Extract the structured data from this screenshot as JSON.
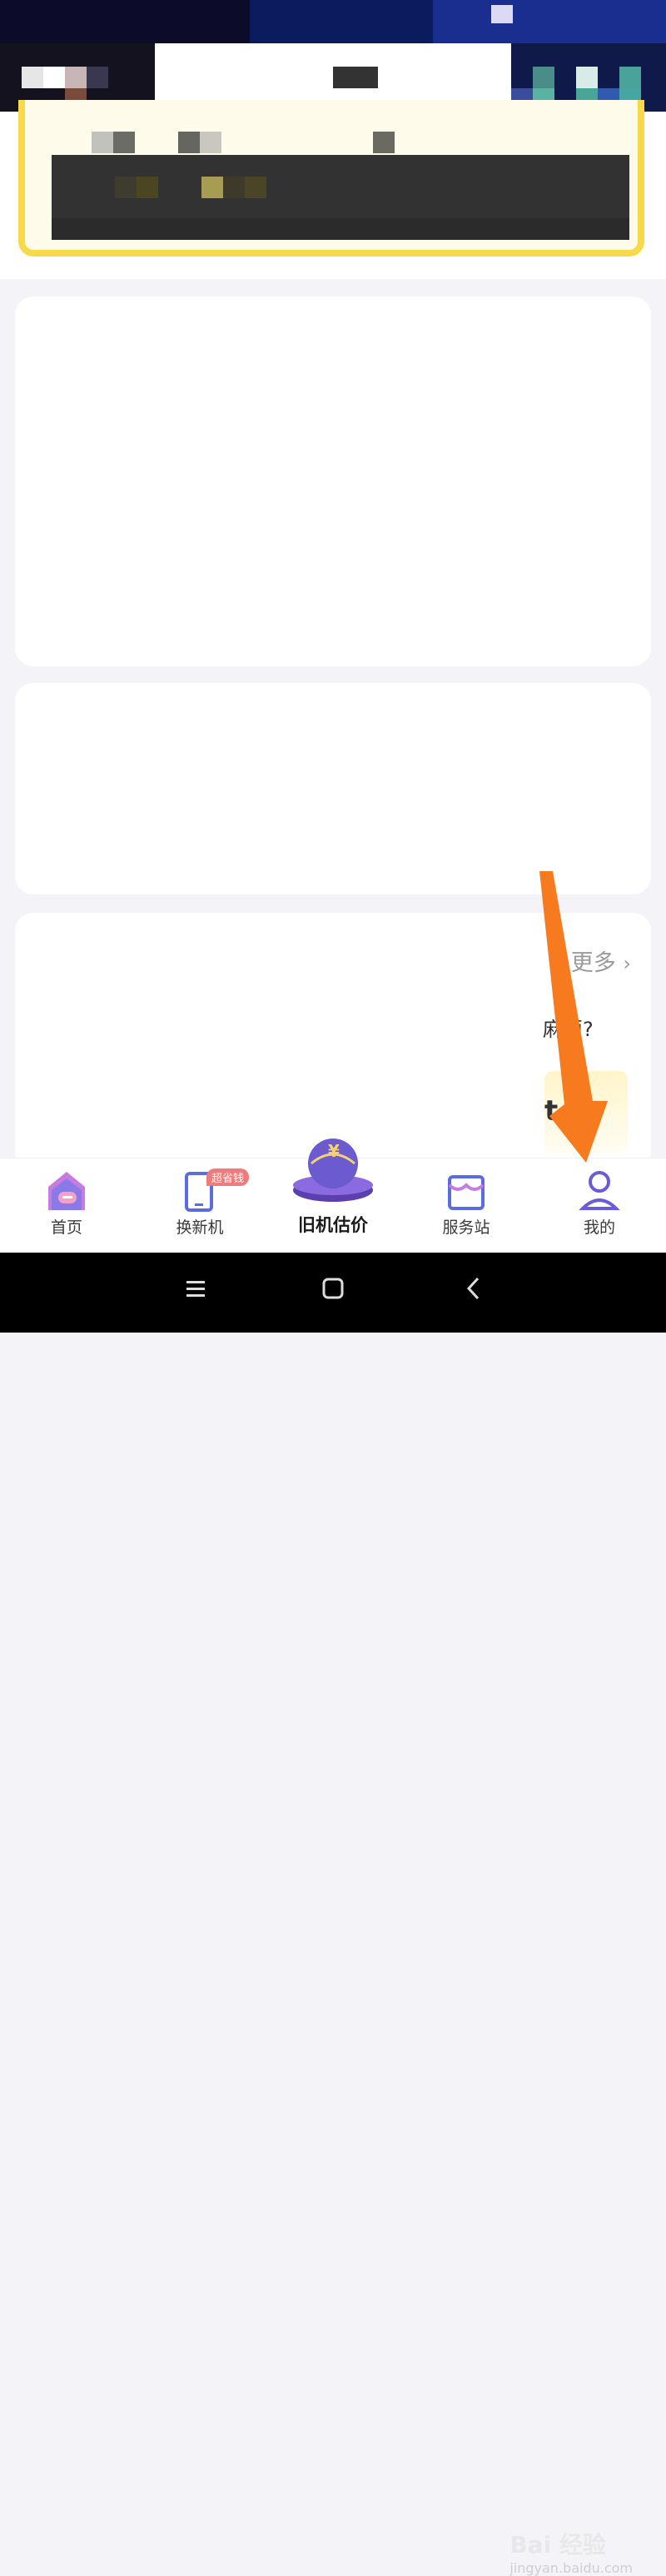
{
  "more_link": {
    "label": "更多"
  },
  "fragments": {
    "text1": "麻烦?",
    "text2": "t"
  },
  "tabbar": {
    "tabs": [
      {
        "label": "首页",
        "icon": "home-icon"
      },
      {
        "label": "换新机",
        "icon": "phone-icon",
        "badge": "超省钱"
      },
      {
        "label": "旧机估价",
        "icon": "globe-icon"
      },
      {
        "label": "服务站",
        "icon": "store-icon"
      },
      {
        "label": "我的",
        "icon": "user-icon"
      }
    ]
  },
  "watermark": {
    "brand": "Bai 经验",
    "url": "jingyan.baidu.com"
  },
  "colors": {
    "accent": "#6a5bd6",
    "arrow": "#f77a1f",
    "yellow": "#f7d94a"
  }
}
